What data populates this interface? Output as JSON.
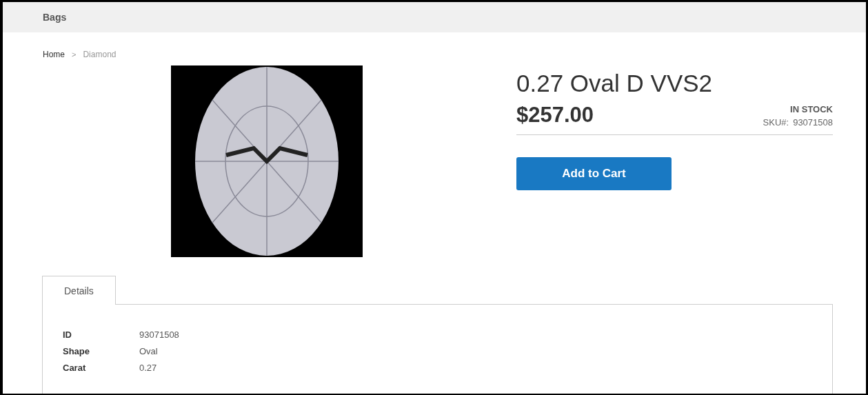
{
  "top_bar": {
    "title": "Bags"
  },
  "breadcrumbs": {
    "separator": ">",
    "items": [
      {
        "label": "Home",
        "current": false
      },
      {
        "label": "Diamond",
        "current": true
      }
    ]
  },
  "product": {
    "title": "0.27 Oval D VVS2",
    "price": "$257.00",
    "stock": "IN STOCK",
    "sku_label": "SKU#:",
    "sku": "93071508",
    "add_button": "Add to Cart"
  },
  "tabs": [
    {
      "label": "Details",
      "selected": true
    }
  ],
  "details": [
    {
      "label": "ID",
      "value": "93071508"
    },
    {
      "label": "Shape",
      "value": "Oval"
    },
    {
      "label": "Carat",
      "value": "0.27"
    }
  ]
}
